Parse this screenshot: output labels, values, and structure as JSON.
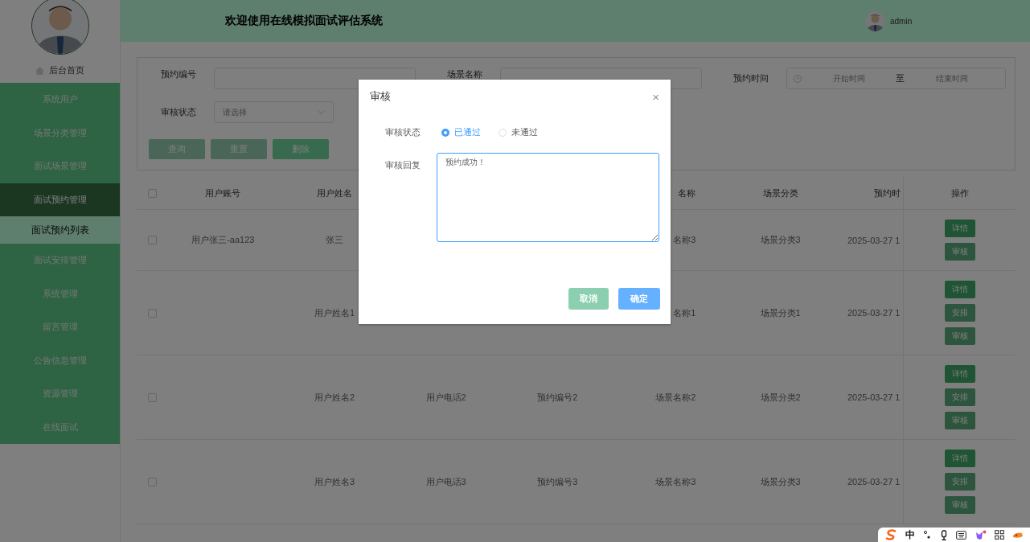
{
  "sidebar": {
    "home": "后台首页",
    "menu": [
      {
        "label": "系统用户",
        "expanded": false
      },
      {
        "label": "场景分类管理",
        "expanded": false
      },
      {
        "label": "面试场景管理",
        "expanded": false
      },
      {
        "label": "面试预约管理",
        "expanded": true,
        "children": [
          {
            "label": "面试预约列表",
            "selected": true
          }
        ]
      },
      {
        "label": "面试安排管理",
        "expanded": false
      },
      {
        "label": "系统管理",
        "expanded": false
      },
      {
        "label": "留言管理",
        "expanded": false
      },
      {
        "label": "公告信息管理",
        "expanded": false
      },
      {
        "label": "资源管理",
        "expanded": false
      },
      {
        "label": "在线面试",
        "expanded": false
      }
    ]
  },
  "header": {
    "title": "欢迎使用在线模拟面试评估系统",
    "user": "admin"
  },
  "search": {
    "fields": [
      {
        "kind": "text",
        "label": "预约编号"
      },
      {
        "kind": "text",
        "label": "场景名称"
      },
      {
        "kind": "daterange",
        "label": "预约时间",
        "start_placeholder": "开始时间",
        "separator": "至",
        "end_placeholder": "结束时间"
      },
      {
        "kind": "select",
        "label": "审核状态",
        "placeholder": "请选择"
      }
    ],
    "buttons": [
      {
        "label": "查询",
        "kind": "plain"
      },
      {
        "label": "重置",
        "kind": "plain"
      },
      {
        "label": "删除",
        "kind": "solid"
      }
    ]
  },
  "table": {
    "all_checked": false,
    "columns": {
      "column_1": "用户账号",
      "column_2": "用户姓名",
      "column_5": "名称",
      "column_6": "场景分类",
      "column_7": "预约时",
      "actions": "操作"
    },
    "rows": [
      {
        "checked": false,
        "column_1": "用户张三-aa123",
        "column_2": "张三",
        "column_5": "名称3",
        "column_6": "场景分类3",
        "column_7": "2025-03-27 1",
        "actions": [
          {
            "label": "详情",
            "kind": "primary"
          },
          {
            "label": "审核",
            "kind": "secondary"
          }
        ]
      },
      {
        "checked": false,
        "column_2": "用户姓名1",
        "column_5": "名称1",
        "column_6": "场景分类1",
        "column_7": "2025-03-27 1",
        "actions": [
          {
            "label": "详情",
            "kind": "primary"
          },
          {
            "label": "安排",
            "kind": "secondary"
          },
          {
            "label": "审核",
            "kind": "secondary"
          }
        ]
      },
      {
        "checked": false,
        "column_2": "用户姓名2",
        "column_3": "用户电话2",
        "column_4": "预约编号2",
        "column_5": "场景名称2",
        "column_6": "场景分类2",
        "column_7": "2025-03-27 1",
        "actions": [
          {
            "label": "详情",
            "kind": "primary"
          },
          {
            "label": "安排",
            "kind": "secondary"
          },
          {
            "label": "审核",
            "kind": "secondary"
          }
        ]
      },
      {
        "checked": false,
        "column_2": "用户姓名3",
        "column_3": "用户电话3",
        "column_4": "预约编号3",
        "column_5": "场景名称3",
        "column_6": "场景分类3",
        "column_7": "2025-03-27 1",
        "actions": [
          {
            "label": "详情",
            "kind": "primary"
          },
          {
            "label": "安排",
            "kind": "secondary"
          },
          {
            "label": "审核",
            "kind": "secondary"
          }
        ]
      }
    ]
  },
  "dialog": {
    "title": "审核",
    "close": "×",
    "fields": [
      {
        "kind": "radio",
        "label": "审核状态",
        "options": [
          {
            "label": "已通过",
            "selected": true
          },
          {
            "label": "未通过",
            "selected": false
          }
        ]
      },
      {
        "kind": "textarea",
        "label": "审核回复",
        "value": "预约成功！"
      }
    ],
    "buttons": [
      {
        "label": "取消",
        "kind": "cancel"
      },
      {
        "label": "确定",
        "kind": "confirm"
      }
    ]
  },
  "ime": {
    "mode": "中"
  }
}
